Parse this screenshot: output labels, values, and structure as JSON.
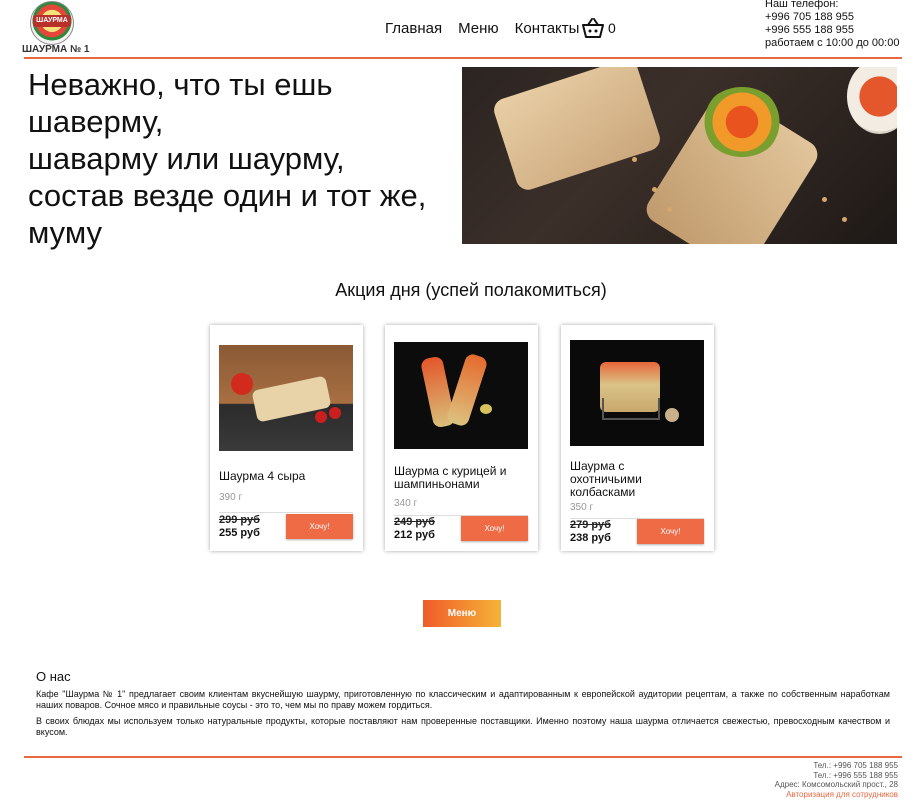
{
  "header": {
    "logo_badge": "ШАУРМА",
    "logo_caption": "ШАУРМА № 1",
    "nav": [
      "Главная",
      "Меню",
      "Контакты"
    ],
    "cart_count": "0",
    "contacts": {
      "label": "Наш телефон:",
      "phone1": "+996 705 188 955",
      "phone2": "+996 555 188 955",
      "hours": "работаем с 10:00 до 00:00"
    }
  },
  "hero": {
    "title_lines": [
      "Неважно, что ты ешь",
      "шаверму,",
      "шаварму или шаурму,",
      "состав везде один и тот же,",
      "муму"
    ]
  },
  "promo": {
    "title": "Акция дня (успей полакомиться)",
    "cards": [
      {
        "name_lines": [
          "Шаурма 4 сыра"
        ],
        "weight": "390 г",
        "old_price": "299 руб",
        "new_price": "255 руб",
        "button": "Хочу!"
      },
      {
        "name_lines": [
          "Шаурма с курицей и",
          "шампиньонами"
        ],
        "weight": "340 г",
        "old_price": "249 руб",
        "new_price": "212 руб",
        "button": "Хочу!"
      },
      {
        "name_lines": [
          "Шаурма с",
          "охотничьими",
          "колбасками"
        ],
        "weight": "350 г",
        "old_price": "279 руб",
        "new_price": "238 руб",
        "button": "Хочу!"
      }
    ]
  },
  "menu_button": "Меню",
  "about": {
    "title": "О нас",
    "p1": "Кафе \"Шаурма № 1\" предлагает своим клиентам вкуснейшую шаурму, приготовленную по классическим и адаптированным к европейской аудитории рецептам, а также по собственным наработкам наших поваров. Сочное мясо и правильные соусы - это то, чем мы по праву можем гордиться.",
    "p2": "В своих блюдах мы используем только натуральные продукты, которые поставляют нам проверенные поставщики. Именно поэтому наша шаурма отличается свежестью, превосходным качеством и вкусом."
  },
  "footer": {
    "tel1": "Тел.: +996 705 188 955",
    "tel2": "Тел.: +996 555 188 955",
    "address": "Адрес: Комсомольский прост., 28",
    "staff_link": "Авторизация для сотрудников"
  },
  "colors": {
    "accent": "#e8683f",
    "button": "#ef6b46"
  },
  "icons": {
    "cart": "basket-icon",
    "logo": "logo-icon"
  }
}
